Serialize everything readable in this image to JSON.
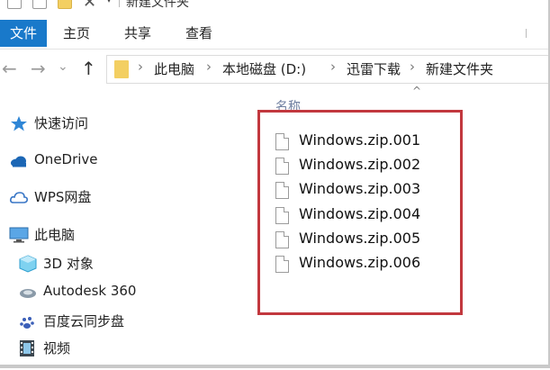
{
  "window": {
    "title_fragment": "新建文件夹"
  },
  "ribbon": {
    "tabs": [
      {
        "label": "文件",
        "active": true
      },
      {
        "label": "主页"
      },
      {
        "label": "共享"
      },
      {
        "label": "查看"
      }
    ]
  },
  "address": {
    "crumbs": [
      "此电脑",
      "本地磁盘 (D:)",
      "迅雷下载",
      "新建文件夹"
    ],
    "separator": "›"
  },
  "nav": {
    "back_icon": "←",
    "forward_icon": "→",
    "history_icon": "⌄",
    "up_icon": "↑"
  },
  "sidebar": {
    "items": [
      {
        "label": "快速访问",
        "icon": "star-icon"
      },
      {
        "label": "OneDrive",
        "icon": "cloud-icon"
      },
      {
        "label": "WPS网盘",
        "icon": "cloud-outline-icon"
      },
      {
        "label": "此电脑",
        "icon": "monitor-icon"
      },
      {
        "label": "3D 对象",
        "icon": "cube-icon"
      },
      {
        "label": "Autodesk 360",
        "icon": "autodesk-icon"
      },
      {
        "label": "百度云同步盘",
        "icon": "baidu-sync-icon"
      },
      {
        "label": "视频",
        "icon": "film-icon"
      }
    ]
  },
  "main": {
    "column_header": "名称",
    "sort_indicator": "^",
    "files": [
      "Windows.zip.001",
      "Windows.zip.002",
      "Windows.zip.003",
      "Windows.zip.004",
      "Windows.zip.005",
      "Windows.zip.006"
    ]
  },
  "colors": {
    "accent": "#1979ca",
    "highlight_border": "#c2383e",
    "folder": "#f3cf62"
  }
}
